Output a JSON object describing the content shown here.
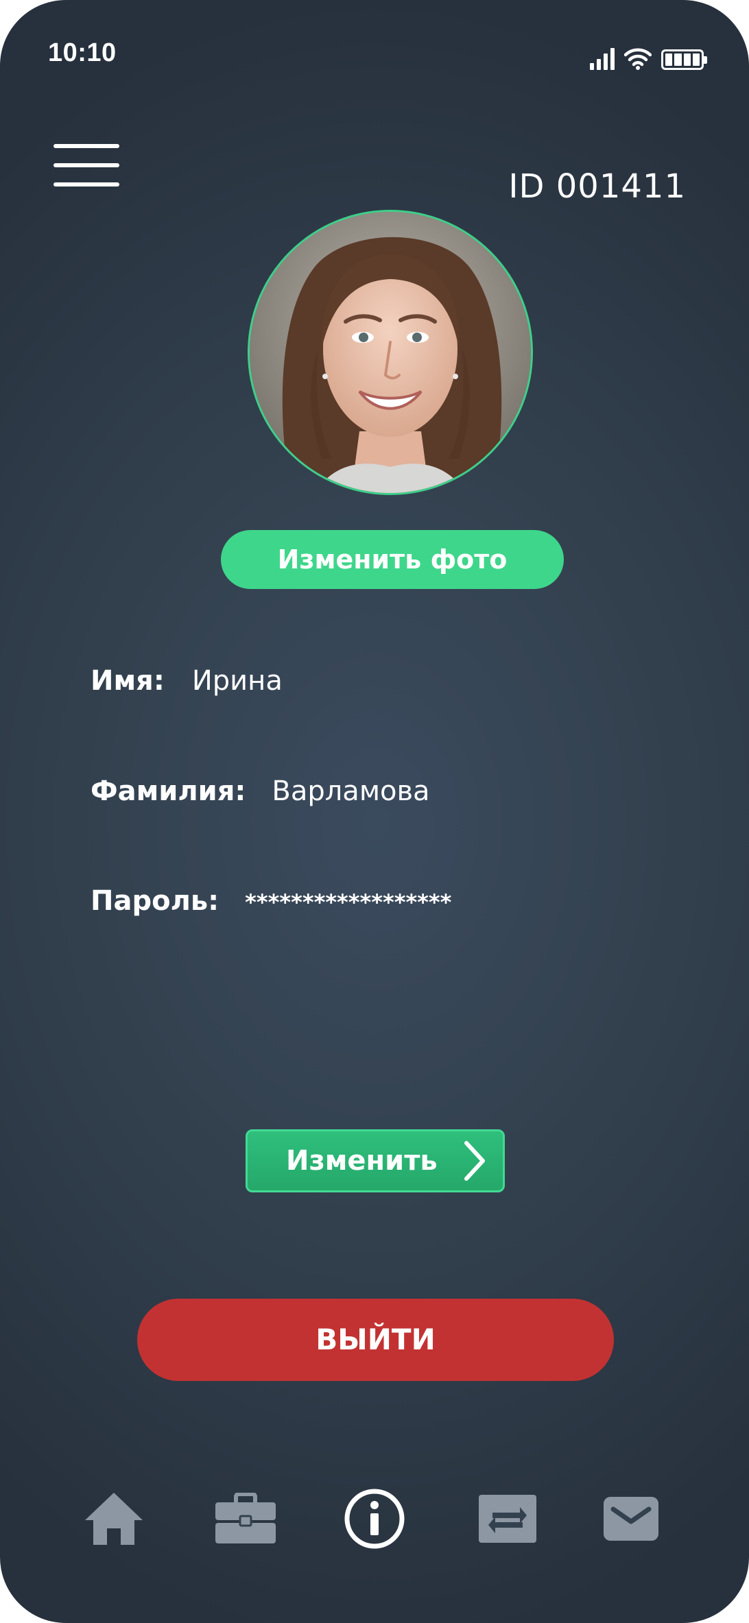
{
  "status_bar": {
    "time": "10:10",
    "icons": [
      "signal-icon",
      "wifi-icon",
      "battery-icon"
    ]
  },
  "header": {
    "menu_icon": "menu-icon",
    "user_id": "ID 001411"
  },
  "profile": {
    "avatar": "profile-photo",
    "change_photo_label": "Изменить фото",
    "fields": {
      "name": {
        "label": "Имя:",
        "value": "Ирина"
      },
      "surname": {
        "label": "Фамилия:",
        "value": "Варламова"
      },
      "password": {
        "label": "Пароль:",
        "value": "******************"
      }
    },
    "edit_label": "Изменить",
    "logout_label": "ВЫЙТИ"
  },
  "bottom_nav": {
    "items": [
      {
        "icon": "home-icon",
        "active": false
      },
      {
        "icon": "briefcase-icon",
        "active": false
      },
      {
        "icon": "info-icon",
        "active": true
      },
      {
        "icon": "transfer-icon",
        "active": false
      },
      {
        "icon": "mail-icon",
        "active": false
      }
    ]
  },
  "colors": {
    "background": "#33414f",
    "accent_green": "#3ed68b",
    "logout_red": "#c33232",
    "nav_inactive": "#8c97a3",
    "nav_active": "#ffffff"
  }
}
